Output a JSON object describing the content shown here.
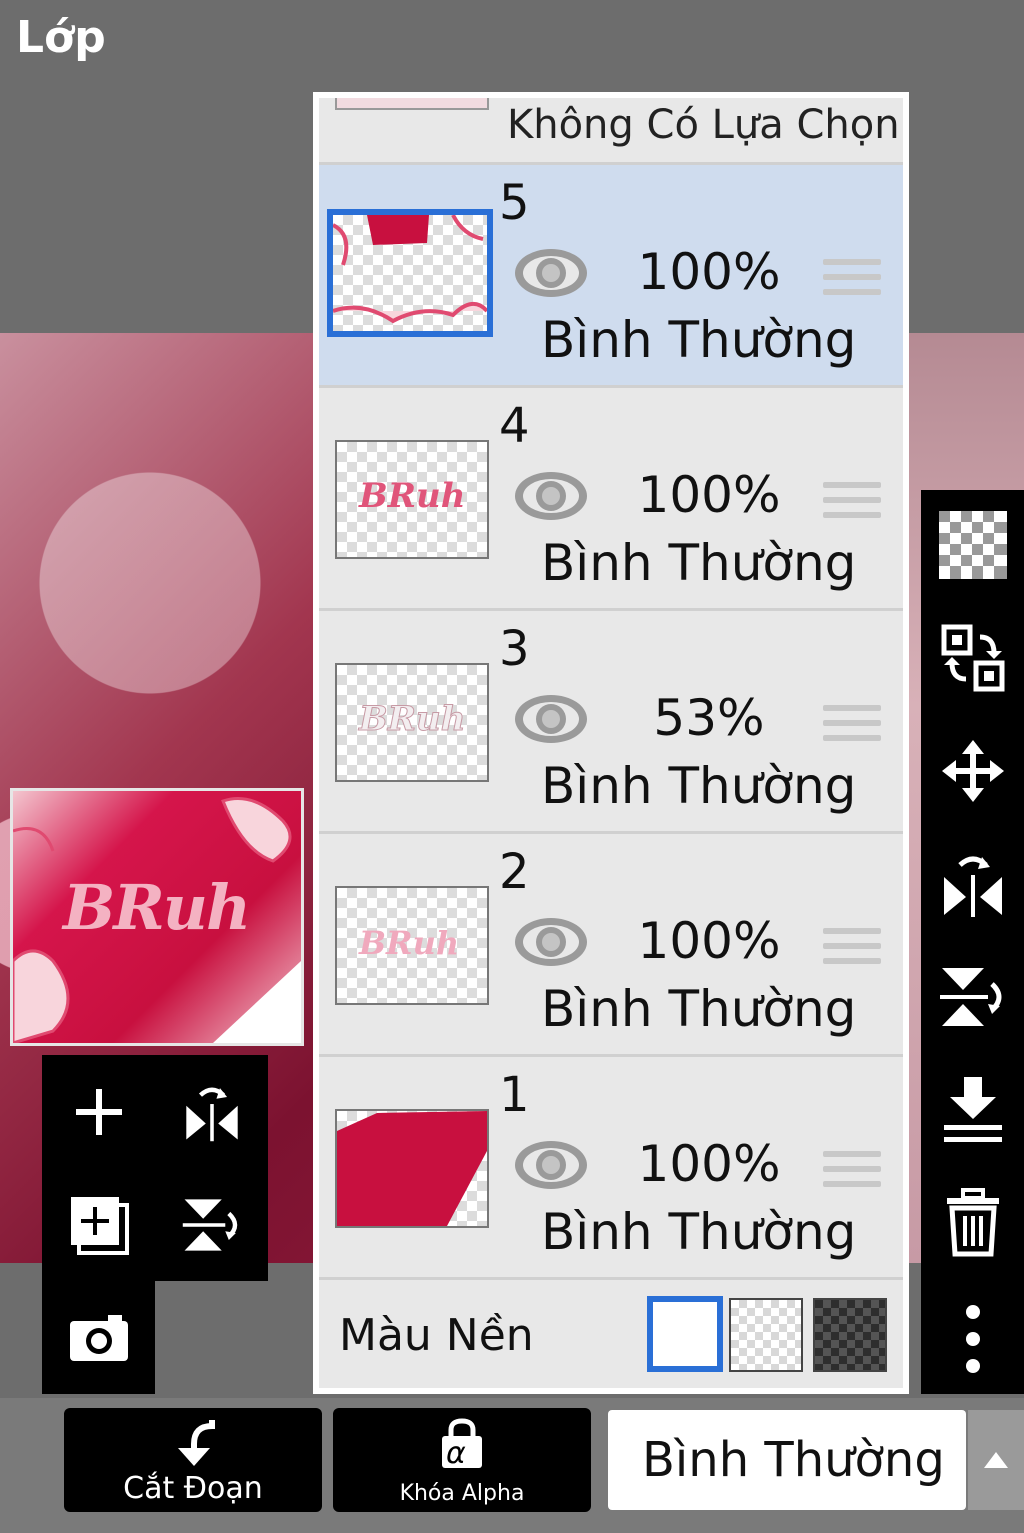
{
  "header": {
    "title": "Lớp"
  },
  "panel": {
    "no_selection_label": "Không Có Lựa Chọn",
    "layers": [
      {
        "number": "5",
        "opacity": "100%",
        "blend": "Bình Thường",
        "selected": true
      },
      {
        "number": "4",
        "opacity": "100%",
        "blend": "Bình Thường",
        "selected": false
      },
      {
        "number": "3",
        "opacity": "53%",
        "blend": "Bình Thường",
        "selected": false
      },
      {
        "number": "2",
        "opacity": "100%",
        "blend": "Bình Thường",
        "selected": false
      },
      {
        "number": "1",
        "opacity": "100%",
        "blend": "Bình Thường",
        "selected": false
      }
    ],
    "background_color_label": "Màu Nền"
  },
  "preview": {
    "text": "BRuh"
  },
  "thumbnails": {
    "layer4_text": "BRuh",
    "layer3_text": "BRuh",
    "layer2_text": "BRuh"
  },
  "bottom_bar": {
    "clip_label": "Cắt Đoạn",
    "alpha_lock_label": "Khóa Alpha",
    "alpha_glyph": "α",
    "blend_mode_value": "Bình Thường"
  },
  "icons": {
    "right_toolbar": [
      "transparency-icon",
      "swap-layers-icon",
      "move-icon",
      "flip-horizontal-icon",
      "flip-vertical-icon",
      "merge-down-icon",
      "trash-icon",
      "more-icon"
    ],
    "left_toolbar": [
      "add-layer-icon",
      "flip-horizontal-icon",
      "add-layer-copy-icon",
      "flip-vertical-icon",
      "camera-icon"
    ]
  },
  "colors": {
    "selected_blue": "#2a6fd6",
    "accent_pink": "#c8103f",
    "panel_bg": "#e8e8e8"
  }
}
